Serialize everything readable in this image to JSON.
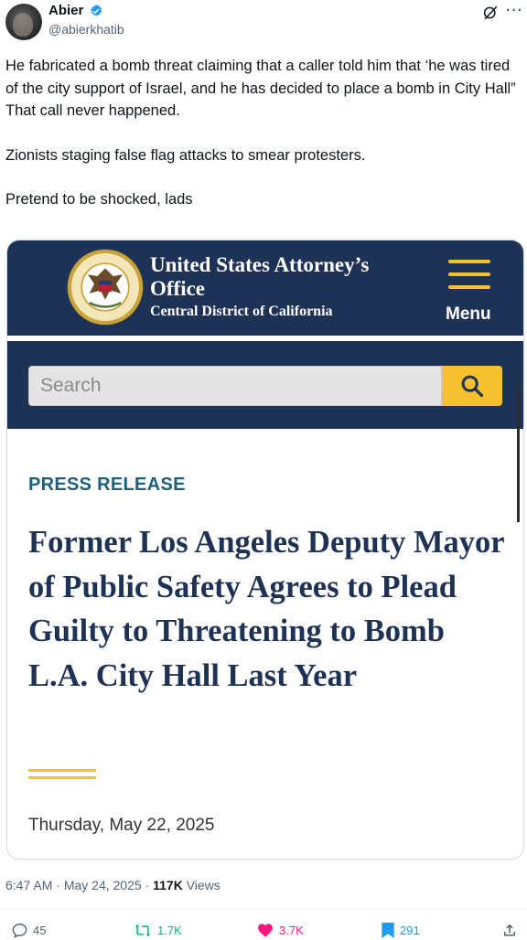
{
  "author": {
    "name": "Abier",
    "handle": "@abierkhatib"
  },
  "tweet": {
    "paragraphs": [
      "He fabricated a bomb threat claiming that a caller told him that ‘he was tired of the city support of Israel, and he has decided to place a bomb in City Hall”",
      "That call never happened.",
      "Zionists staging false flag attacks to smear protesters.",
      "Pretend to be shocked, lads"
    ]
  },
  "card": {
    "office_title": "United States Attorney’s Office",
    "office_subtitle": "Central District of California",
    "menu_label": "Menu",
    "search_placeholder": "Search",
    "label": "PRESS RELEASE",
    "headline": "Former Los Angeles Deputy Mayor of Public Safety Agrees to Plead Guilty to Threatening to Bomb L.A. City Hall Last Year",
    "date": "Thursday, May 22, 2025"
  },
  "meta": {
    "time": "6:47 AM",
    "date": "May 24, 2025",
    "views_count": "117K",
    "views_label": "Views"
  },
  "actions": {
    "replies": "45",
    "reposts": "1.7K",
    "likes": "3.7K",
    "bookmarks": "291"
  },
  "colors": {
    "doj_navy": "#1e3256",
    "doj_gold": "#f5c12e",
    "press_teal": "#1f5f7a",
    "verified_blue": "#1d9bf0",
    "repost_green": "#00ba7c",
    "like_pink": "#f91880",
    "bookmark_blue": "#1d9bf0"
  },
  "icons": [
    "verified-badge-icon",
    "grok-icon",
    "more-icon",
    "doj-seal-icon",
    "hamburger-menu-icon",
    "magnifier-icon",
    "reply-icon",
    "repost-icon",
    "heart-icon",
    "bookmark-icon",
    "share-icon"
  ]
}
